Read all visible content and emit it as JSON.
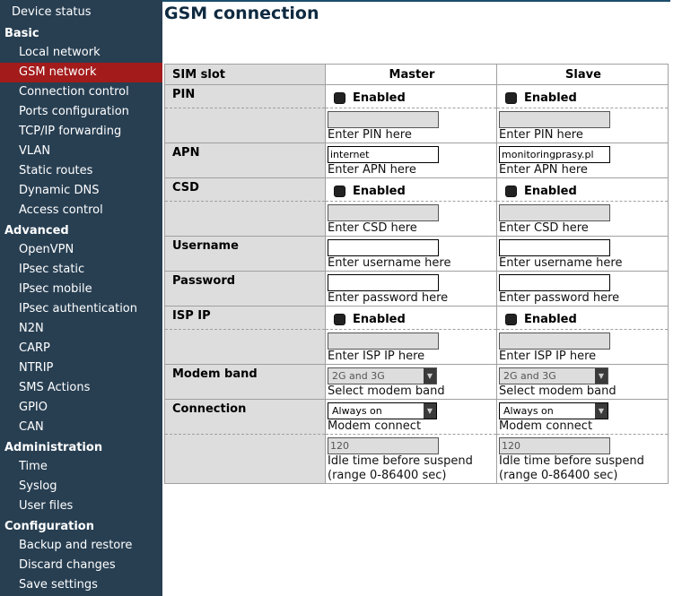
{
  "sidebar": {
    "top_item": "Device status",
    "sections": [
      {
        "title": "Basic",
        "items": [
          "Local network",
          "GSM network",
          "Connection control",
          "Ports configuration",
          "TCP/IP forwarding",
          "VLAN",
          "Static routes",
          "Dynamic DNS",
          "Access control"
        ]
      },
      {
        "title": "Advanced",
        "items": [
          "OpenVPN",
          "IPsec static",
          "IPsec mobile",
          "IPsec authentication",
          "N2N",
          "CARP",
          "NTRIP",
          "SMS Actions",
          "GPIO",
          "CAN"
        ]
      },
      {
        "title": "Administration",
        "items": [
          "Time",
          "Syslog",
          "User files"
        ]
      },
      {
        "title": "Configuration",
        "items": [
          "Backup and restore",
          "Discard changes",
          "Save settings"
        ]
      }
    ],
    "active_item": "GSM network",
    "active_color": "#a31b1b",
    "bg_color": "#283f52"
  },
  "page": {
    "title": "GSM connection"
  },
  "table": {
    "header": {
      "label": "SIM slot",
      "master": "Master",
      "slave": "Slave"
    },
    "enabled_label": "Enabled",
    "pin": {
      "label": "PIN",
      "master_enabled": false,
      "slave_enabled": false,
      "master_value": "",
      "slave_value": "",
      "hint": "Enter PIN here"
    },
    "apn": {
      "label": "APN",
      "master_value": "internet",
      "slave_value": "monitoringprasy.pl",
      "hint": "Enter APN here"
    },
    "csd": {
      "label": "CSD",
      "master_enabled": false,
      "slave_enabled": false,
      "master_value": "",
      "slave_value": "",
      "hint": "Enter CSD here"
    },
    "username": {
      "label": "Username",
      "master_value": "",
      "slave_value": "",
      "hint": "Enter username here"
    },
    "password": {
      "label": "Password",
      "master_value": "",
      "slave_value": "",
      "hint": "Enter password here"
    },
    "isp_ip": {
      "label": "ISP IP",
      "master_enabled": false,
      "slave_enabled": false,
      "master_value": "",
      "slave_value": "",
      "hint": "Enter ISP IP here"
    },
    "modem_band": {
      "label": "Modem band",
      "master_value": "2G and 3G",
      "slave_value": "2G and 3G",
      "hint": "Select modem band"
    },
    "connection": {
      "label": "Connection",
      "master_value": "Always on",
      "slave_value": "Always on",
      "hint": "Modem connect"
    },
    "idle": {
      "master_value": "120",
      "slave_value": "120",
      "hint_line1": "Idle time before suspend",
      "hint_line2": "(range 0-86400 sec)"
    }
  }
}
